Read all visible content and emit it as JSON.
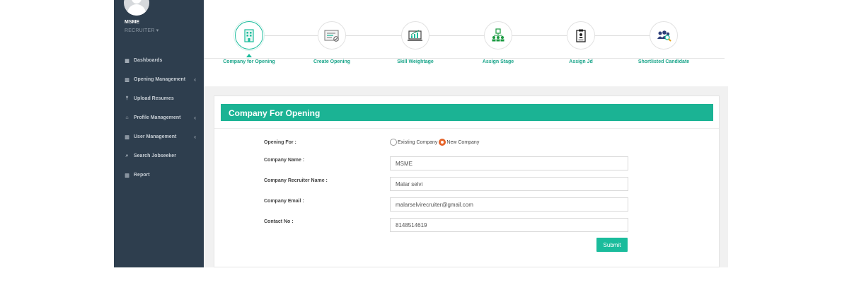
{
  "user": {
    "name": "MSME",
    "role": "RECRUITER ▾"
  },
  "sidebar": {
    "items": [
      {
        "label": "Dashboards",
        "icon": "grid-icon",
        "glyph": "▦",
        "has_chevron": false
      },
      {
        "label": "Opening Management",
        "icon": "bar-chart-icon",
        "glyph": "▥",
        "has_chevron": true
      },
      {
        "label": "Upload Resumes",
        "icon": "upload-icon",
        "glyph": "⤒",
        "has_chevron": false
      },
      {
        "label": "Profile Management",
        "icon": "briefcase-icon",
        "glyph": "⌂",
        "has_chevron": true
      },
      {
        "label": "User Management",
        "icon": "bar-chart-icon",
        "glyph": "▥",
        "has_chevron": true
      },
      {
        "label": "Search Jobseeker",
        "icon": "search-icon",
        "glyph": "⌕",
        "has_chevron": false
      },
      {
        "label": "Report",
        "icon": "bar-chart-icon",
        "glyph": "▥",
        "has_chevron": false
      }
    ],
    "chevron": "‹"
  },
  "steps": [
    {
      "label": "Company for Opening",
      "icon": "building-icon",
      "active": true
    },
    {
      "label": "Create Opening",
      "icon": "certificate-icon",
      "active": false
    },
    {
      "label": "Skill Weightage",
      "icon": "chart-laptop-icon",
      "active": false
    },
    {
      "label": "Assign Stage",
      "icon": "org-chart-icon",
      "active": false
    },
    {
      "label": "Assign Jd",
      "icon": "document-icon",
      "active": false
    },
    {
      "label": "Shortlisted Candidate",
      "icon": "team-search-icon",
      "active": false
    }
  ],
  "form": {
    "title": "Company For Opening",
    "opening_for_label": "Opening For :",
    "options": [
      {
        "label": "Existing Company",
        "checked": false
      },
      {
        "label": "New Company",
        "checked": true
      }
    ],
    "company_name_label": "Company Name :",
    "company_name_value": "MSME",
    "recruiter_name_label": "Company Recruiter Name :",
    "recruiter_name_value": "Malar selvi",
    "email_label": "Company Email :",
    "email_value": "malarselvirecruiter@gmail.com",
    "contact_label": "Contact No :",
    "contact_value": "8148514619",
    "submit_label": "Submit"
  },
  "colors": {
    "sidebar": "#2e3e4e",
    "accent": "#1abc9c",
    "radio_checked": "#e8692f"
  }
}
